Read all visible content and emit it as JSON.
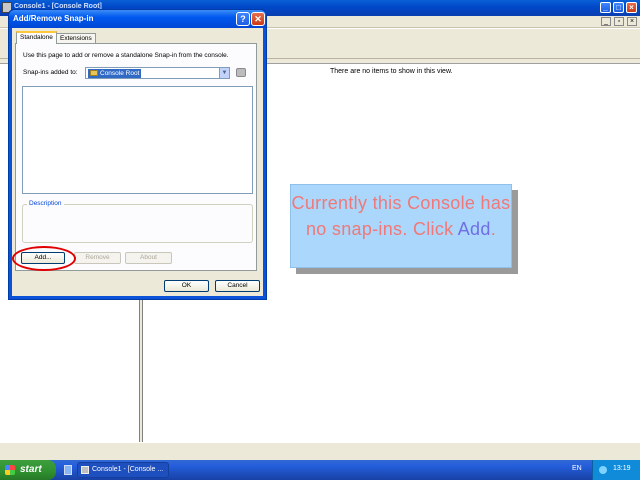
{
  "mmc": {
    "title": "Console1 - [Console Root]",
    "empty_message": "There are no items to show in this view."
  },
  "dialog": {
    "title": "Add/Remove Snap-in",
    "tabs": [
      "Standalone",
      "Extensions"
    ],
    "instruction": "Use this page to add or remove a standalone Snap-in from the console.",
    "snapins_added_label": "Snap-ins added to:",
    "snapins_added_value": "Console Root",
    "description_label": "Description",
    "buttons": {
      "add": "Add...",
      "remove": "Remove",
      "about": "About",
      "ok": "OK",
      "cancel": "Cancel"
    },
    "help_glyph": "?",
    "close_glyph": "✕"
  },
  "callout": {
    "text_before": "Currently this Console has no snap-ins. Click ",
    "highlight": "Add",
    "text_after": ".",
    "colors": {
      "background": "#aad7fb",
      "text": "#f07878",
      "highlight": "#6f6fe6"
    }
  },
  "taskbar": {
    "start_label": "start",
    "task_label": "Console1 - [Console ...",
    "language": "EN",
    "clock": "13:19"
  },
  "icons": [
    "mmc-app-icon",
    "minimize-icon",
    "maximize-icon",
    "close-icon",
    "help-icon",
    "folder-icon",
    "dropdown-arrow-icon",
    "snapin-icon",
    "windows-logo-icon",
    "tray-icon"
  ]
}
